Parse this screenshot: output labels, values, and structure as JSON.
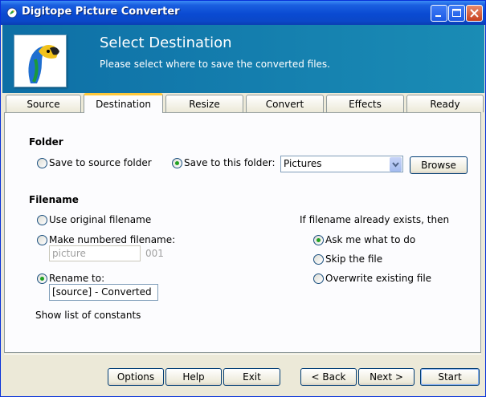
{
  "window": {
    "title": "Digitope Picture Converter"
  },
  "header": {
    "title": "Select Destination",
    "subtitle": "Please select where to save the converted files."
  },
  "tabs": [
    {
      "label": "Source",
      "active": false
    },
    {
      "label": "Destination",
      "active": true
    },
    {
      "label": "Resize",
      "active": false
    },
    {
      "label": "Convert",
      "active": false
    },
    {
      "label": "Effects",
      "active": false
    },
    {
      "label": "Ready",
      "active": false
    }
  ],
  "folder": {
    "heading": "Folder",
    "save_source_label": "Save to source folder",
    "save_this_label": "Save to this folder:",
    "selected_option": "save_this",
    "folder_value": "Pictures",
    "browse_label": "Browse"
  },
  "filename": {
    "heading": "Filename",
    "original_label": "Use original filename",
    "numbered_label": "Make numbered filename:",
    "numbered_placeholder": "picture",
    "numbered_suffix": "001",
    "rename_label": "Rename to:",
    "rename_value": "[source] - Converted",
    "selected_option": "rename",
    "constants_link": "Show list of constants"
  },
  "exists": {
    "heading": "If filename already exists, then",
    "ask_label": "Ask me what to do",
    "skip_label": "Skip the file",
    "overwrite_label": "Overwrite existing file",
    "selected_option": "ask"
  },
  "footer": {
    "options_label": "Options",
    "help_label": "Help",
    "exit_label": "Exit",
    "back_label": "< Back",
    "next_label": "Next >",
    "start_label": "Start"
  },
  "colors": {
    "titlebar": "#0a4ad2",
    "header": "#0e6fa6",
    "active_tab_accent": "#ffc83c"
  }
}
